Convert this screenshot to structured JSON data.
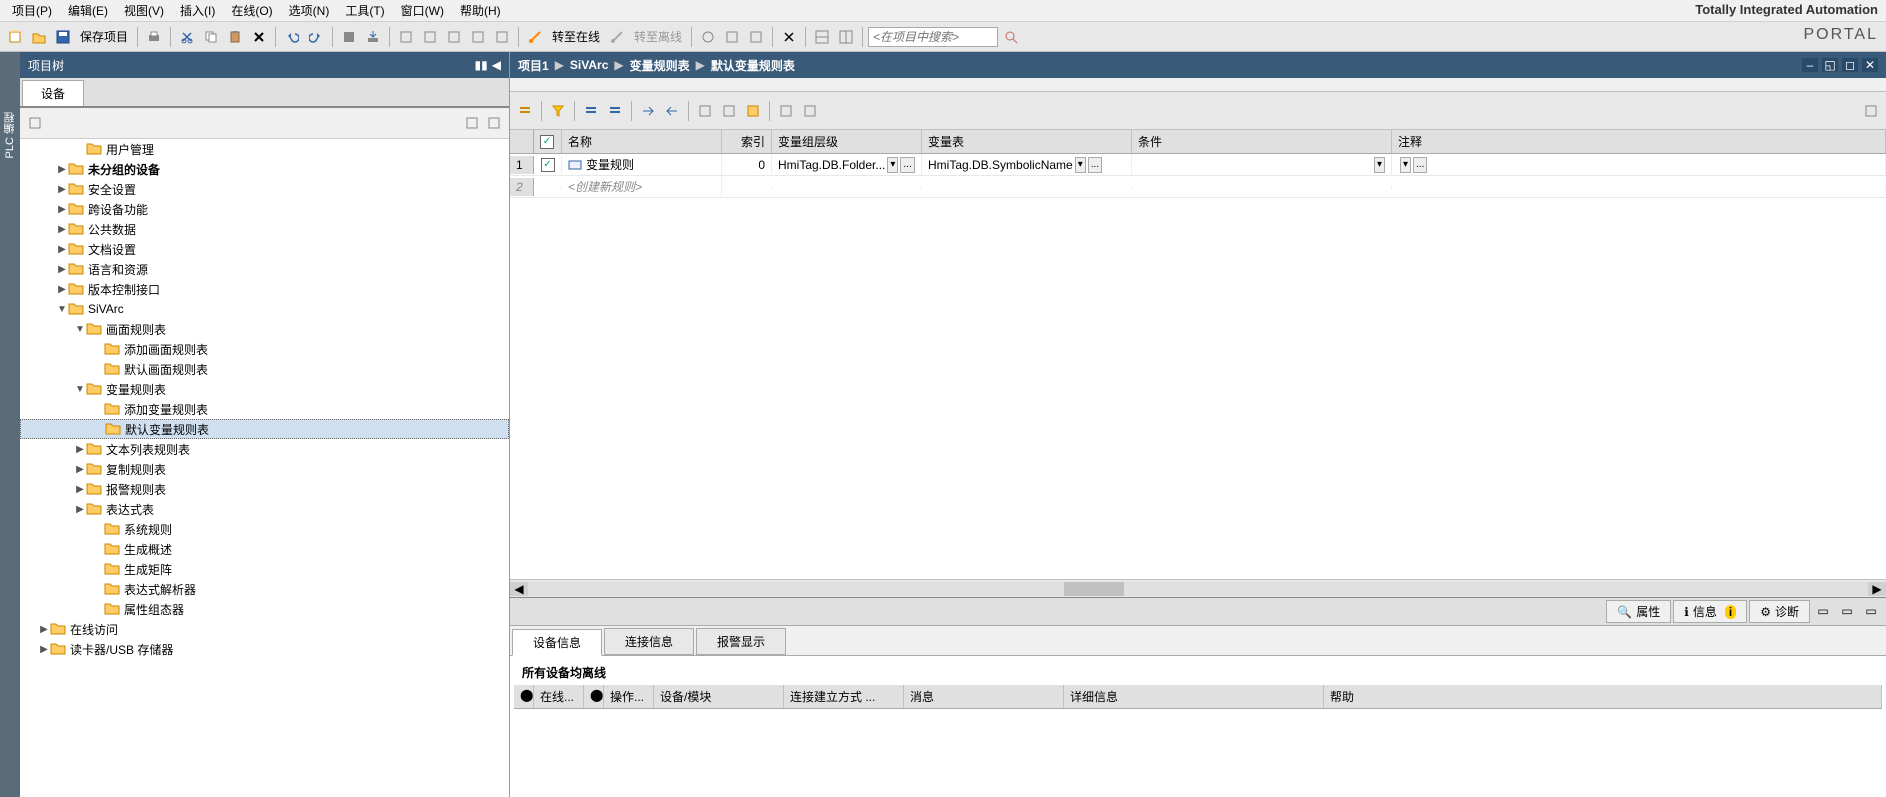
{
  "menubar": {
    "items": [
      "项目(P)",
      "编辑(E)",
      "视图(V)",
      "插入(I)",
      "在线(O)",
      "选项(N)",
      "工具(T)",
      "窗口(W)",
      "帮助(H)"
    ]
  },
  "branding": {
    "line1": "Totally Integrated Automation",
    "line2": "PORTAL"
  },
  "toolbar": {
    "save_label": "保存项目",
    "go_online": "转至在线",
    "go_offline": "转至离线",
    "search_placeholder": "<在项目中搜索>"
  },
  "project_tree": {
    "title": "项目树",
    "tab": "设备",
    "nodes": [
      {
        "indent": 3,
        "toggle": "",
        "label": "用户管理"
      },
      {
        "indent": 2,
        "toggle": "▶",
        "label": "未分组的设备",
        "bold": true
      },
      {
        "indent": 2,
        "toggle": "▶",
        "label": "安全设置"
      },
      {
        "indent": 2,
        "toggle": "▶",
        "label": "跨设备功能"
      },
      {
        "indent": 2,
        "toggle": "▶",
        "label": "公共数据"
      },
      {
        "indent": 2,
        "toggle": "▶",
        "label": "文档设置"
      },
      {
        "indent": 2,
        "toggle": "▶",
        "label": "语言和资源"
      },
      {
        "indent": 2,
        "toggle": "▶",
        "label": "版本控制接口"
      },
      {
        "indent": 2,
        "toggle": "▼",
        "label": "SiVArc"
      },
      {
        "indent": 3,
        "toggle": "▼",
        "label": "画面规则表"
      },
      {
        "indent": 4,
        "toggle": "",
        "label": "添加画面规则表"
      },
      {
        "indent": 4,
        "toggle": "",
        "label": "默认画面规则表"
      },
      {
        "indent": 3,
        "toggle": "▼",
        "label": "变量规则表"
      },
      {
        "indent": 4,
        "toggle": "",
        "label": "添加变量规则表"
      },
      {
        "indent": 4,
        "toggle": "",
        "label": "默认变量规则表",
        "selected": true
      },
      {
        "indent": 3,
        "toggle": "▶",
        "label": "文本列表规则表"
      },
      {
        "indent": 3,
        "toggle": "▶",
        "label": "复制规则表"
      },
      {
        "indent": 3,
        "toggle": "▶",
        "label": "报警规则表"
      },
      {
        "indent": 3,
        "toggle": "▶",
        "label": "表达式表"
      },
      {
        "indent": 4,
        "toggle": "",
        "label": "系统规则"
      },
      {
        "indent": 4,
        "toggle": "",
        "label": "生成概述"
      },
      {
        "indent": 4,
        "toggle": "",
        "label": "生成矩阵"
      },
      {
        "indent": 4,
        "toggle": "",
        "label": "表达式解析器"
      },
      {
        "indent": 4,
        "toggle": "",
        "label": "属性组态器"
      },
      {
        "indent": 1,
        "toggle": "▶",
        "label": "在线访问"
      },
      {
        "indent": 1,
        "toggle": "▶",
        "label": "读卡器/USB 存储器"
      }
    ]
  },
  "breadcrumb": {
    "segments": [
      "项目1",
      "SiVArc",
      "变量规则表",
      "默认变量规则表"
    ]
  },
  "grid": {
    "headers": {
      "name": "名称",
      "index": "索引",
      "group": "变量组层级",
      "table": "变量表",
      "cond": "条件",
      "comment": "注释"
    },
    "rows": [
      {
        "num": "1",
        "checked": true,
        "name": "变量规则",
        "index": "0",
        "group": "HmiTag.DB.Folder...",
        "table": "HmiTag.DB.SymbolicName",
        "cond": "",
        "comment": ""
      }
    ],
    "new_row_placeholder": "<创建新规则>"
  },
  "inspector": {
    "right_tabs": {
      "properties": "属性",
      "info": "信息",
      "diagnostics": "诊断"
    },
    "sub_tabs": {
      "device_info": "设备信息",
      "conn_info": "连接信息",
      "alarm": "报警显示"
    },
    "status_text": "所有设备均离线",
    "cols": {
      "online": "在线...",
      "op": "操作...",
      "device": "设备/模块",
      "conn": "连接建立方式 ...",
      "msg": "消息",
      "detail": "详细信息",
      "help": "帮助"
    }
  },
  "left_strip": {
    "label": "PLC 编程"
  }
}
